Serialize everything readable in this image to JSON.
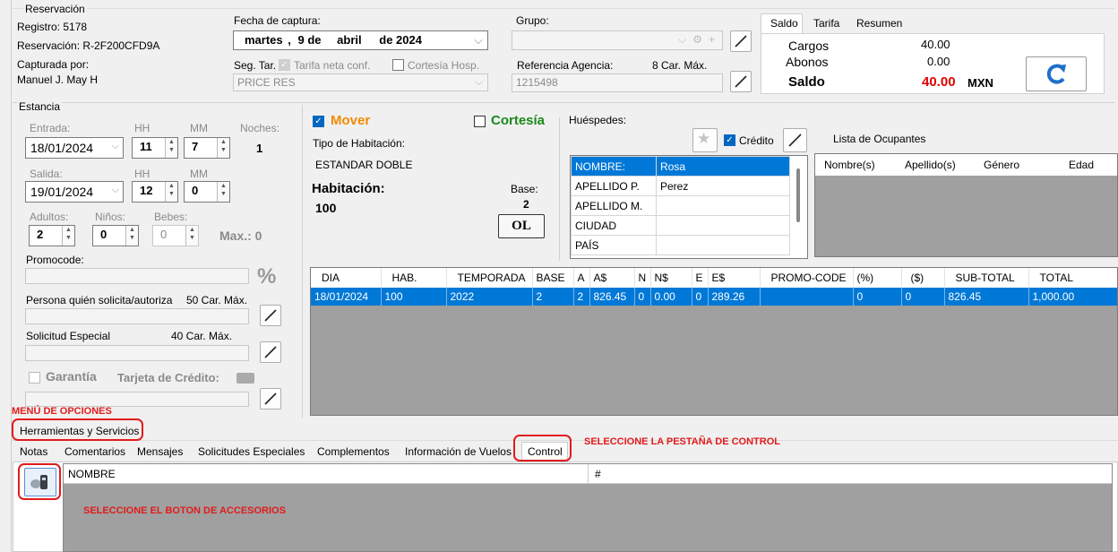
{
  "reservacion": {
    "title": "Reservación",
    "registro": "Registro: 5178",
    "reservacion": "Reservación: R-2F200CFD9A",
    "capturada_label": "Capturada por:",
    "capturada_value": "Manuel J.  May H"
  },
  "fecha": {
    "label": "Fecha de captura:",
    "weekday": "martes",
    "sep": ",",
    "day": "9 de",
    "month": "abril",
    "year": "de 2024"
  },
  "segtar": {
    "label": "Seg. Tar.",
    "tarifa_neta": "Tarifa neta conf.",
    "cortesia_hosp": "Cortesía Hosp.",
    "value": "PRICE RES"
  },
  "grupo": {
    "label": "Grupo:"
  },
  "referencia": {
    "label": "Referencia Agencia:",
    "max": "8 Car. Máx.",
    "value": "1215498"
  },
  "saldo_panel": {
    "tabs": [
      "Saldo",
      "Tarifa",
      "Resumen"
    ],
    "cargos_label": "Cargos",
    "cargos_value": "40.00",
    "abonos_label": "Abonos",
    "abonos_value": "0.00",
    "saldo_label": "Saldo",
    "saldo_value": "40.00",
    "currency": "MXN",
    "saldo_color": "#e00000"
  },
  "estancia": {
    "title": "Estancia",
    "entrada_label": "Entrada:",
    "hh": "HH",
    "mm": "MM",
    "noches_label": "Noches:",
    "entrada": "18/01/2024",
    "entrada_hh": "11",
    "entrada_mm": "7",
    "noches": "1",
    "salida_label": "Salida:",
    "salida": "19/01/2024",
    "salida_hh": "12",
    "salida_mm": "0",
    "adultos_label": "Adultos:",
    "ninos_label": "Niños:",
    "bebes_label": "Bebes:",
    "adultos": "2",
    "ninos": "0",
    "bebes": "0",
    "max": "Max.: 0",
    "promocode_label": "Promocode:",
    "persona_label": "Persona quién solicita/autoriza",
    "persona_max": "50 Car. Máx.",
    "solicitud_label": "Solicitud Especial",
    "solicitud_max": "40 Car. Máx.",
    "garantia_label": "Garantía",
    "tarjeta_label": "Tarjeta de Crédito:"
  },
  "habitacion": {
    "mover": "Mover",
    "cortesia": "Cortesía",
    "tipo_label": "Tipo de Habitación:",
    "tipo_value": "ESTANDAR DOBLE",
    "hab_label": "Habitación:",
    "hab_value": "100",
    "base_label": "Base:",
    "base_value": "2",
    "ol": "OL"
  },
  "huespedes": {
    "label": "Huéspedes:",
    "credito": "Crédito",
    "rows": [
      {
        "k": "NOMBRE:",
        "v": "Rosa"
      },
      {
        "k": "APELLIDO P.",
        "v": "Perez"
      },
      {
        "k": "APELLIDO M.",
        "v": ""
      },
      {
        "k": "CIUDAD",
        "v": ""
      },
      {
        "k": "PAÍS",
        "v": ""
      }
    ],
    "lista_label": "Lista de Ocupantes",
    "ocupantes_cols": [
      "Nombre(s)",
      "Apellido(s)",
      "Género",
      "Edad"
    ]
  },
  "tarifas_grid": {
    "columns": [
      "DIA",
      "HAB.",
      "TEMPORADA",
      "BASE",
      "A",
      "A$",
      "N",
      "N$",
      "E",
      "E$",
      "PROMO-CODE",
      "(%)",
      "($)",
      "SUB-TOTAL",
      "TOTAL"
    ],
    "rows": [
      [
        "18/01/2024",
        "100",
        "2022",
        "2",
        "2",
        "826.45",
        "0",
        "0.00",
        "0",
        "289.26",
        "",
        "0",
        "0",
        "826.45",
        "1,000.00"
      ]
    ]
  },
  "annotations": {
    "menu_opciones": "MENÚ DE OPCIONES",
    "seleccione_pestana": "SELECCIONE LA PESTAÑA DE CONTROL",
    "seleccione_boton": "SELECCIONE EL BOTON DE ACCESORIOS"
  },
  "bottom": {
    "menu": "Herramientas y Servicios",
    "tabs": [
      "Notas",
      "Comentarios",
      "Mensajes",
      "Solicitudes Especiales",
      "Complementos",
      "Información de Vuelos",
      "Control"
    ],
    "col_nombre": "NOMBRE",
    "col_num": "#"
  }
}
